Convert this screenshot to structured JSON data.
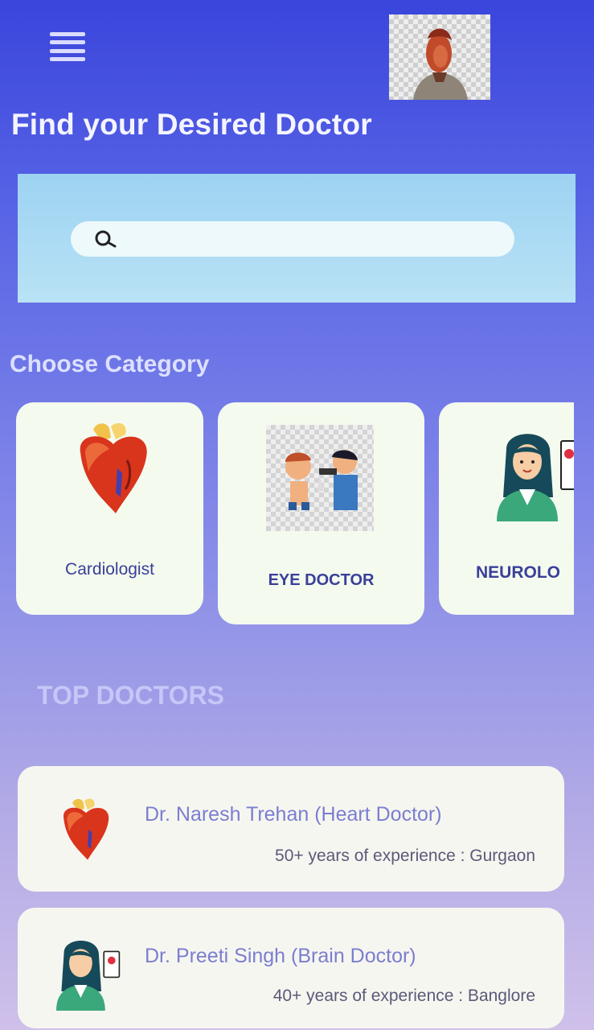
{
  "header": {
    "menu_icon": "hamburger-menu-icon",
    "avatar_icon": "user-avatar-image",
    "title": "Find your Desired Doctor"
  },
  "search": {
    "icon": "search-icon",
    "placeholder": "",
    "value": ""
  },
  "categories": {
    "heading": "Choose Category",
    "items": [
      {
        "label": "Cardiologist",
        "icon": "heart-icon"
      },
      {
        "label": "EYE DOCTOR",
        "icon": "eye-exam-icon"
      },
      {
        "label": "NEUROLO",
        "icon": "neurologist-icon"
      }
    ]
  },
  "top_doctors": {
    "heading": "TOP DOCTORS",
    "items": [
      {
        "name": "Dr. Naresh Trehan  (Heart Doctor)",
        "meta": "50+ years of experience : Gurgaon",
        "icon": "heart-icon"
      },
      {
        "name": "Dr. Preeti Singh  (Brain Doctor)",
        "meta": "40+ years of experience : Banglore",
        "icon": "neurologist-icon"
      }
    ]
  },
  "colors": {
    "background_top": "#3a45dc",
    "background_bottom": "#cfc0ea",
    "card_bg": "#f4fbee",
    "search_panel": "#9dd3f2",
    "category_text": "#3a3f9a"
  }
}
